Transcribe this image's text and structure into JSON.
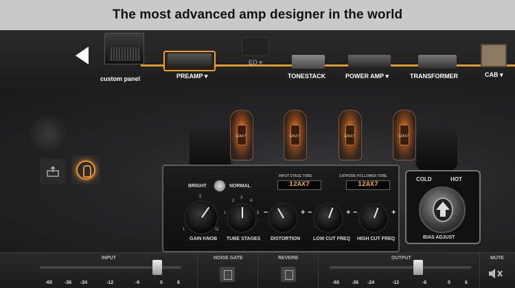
{
  "banner": {
    "text": "The most advanced amp designer in the world"
  },
  "chain": {
    "modules": {
      "custom": {
        "label": "custom panel"
      },
      "preamp": {
        "label": "PREAMP ▾"
      },
      "eq": {
        "label": "EQ ▾"
      },
      "tonestack": {
        "label": "TONESTACK"
      },
      "poweramp": {
        "label": "POWER AMP ▾"
      },
      "transformer": {
        "label": "TRANSFORMER"
      },
      "cab": {
        "label": "CAB ▾"
      }
    },
    "accent": "#e09a2e"
  },
  "preamp": {
    "bright": "BRIGHT",
    "normal": "NORMAL",
    "input_stage_label": "INPUT STAGE TUBE",
    "input_stage_value": "12AX7",
    "cathode_label": "CATHODE FOLLOWER TUBE",
    "cathode_value": "12AX7",
    "tube_tag": "12AX7",
    "knobs": {
      "gain": "GAIN KNOB",
      "stages": "TUBE STAGES",
      "distortion": "DISTORTION",
      "low_cut": "LOW CUT FREQ",
      "high_cut": "HIGH CUT FREQ"
    },
    "gain_ticks": {
      "min": "1",
      "mid": "5",
      "max": "11"
    },
    "stage_ticks": {
      "t1": "1",
      "t2": "2",
      "t3": "3",
      "t4": "4",
      "t5": "5"
    },
    "minus": "−",
    "plus": "+"
  },
  "bias": {
    "cold": "COLD",
    "hot": "HOT",
    "label": "BIAS ADJUST"
  },
  "bottom": {
    "input": "INPUT",
    "noise_gate": "NOISE GATE",
    "reverb": "REVERB",
    "output": "OUTPUT",
    "mute": "MUTE",
    "scale": {
      "a": "-60",
      "b": "-36",
      "c": "-24",
      "d": "-12",
      "e": "-6",
      "f": "0",
      "g": "6"
    }
  }
}
